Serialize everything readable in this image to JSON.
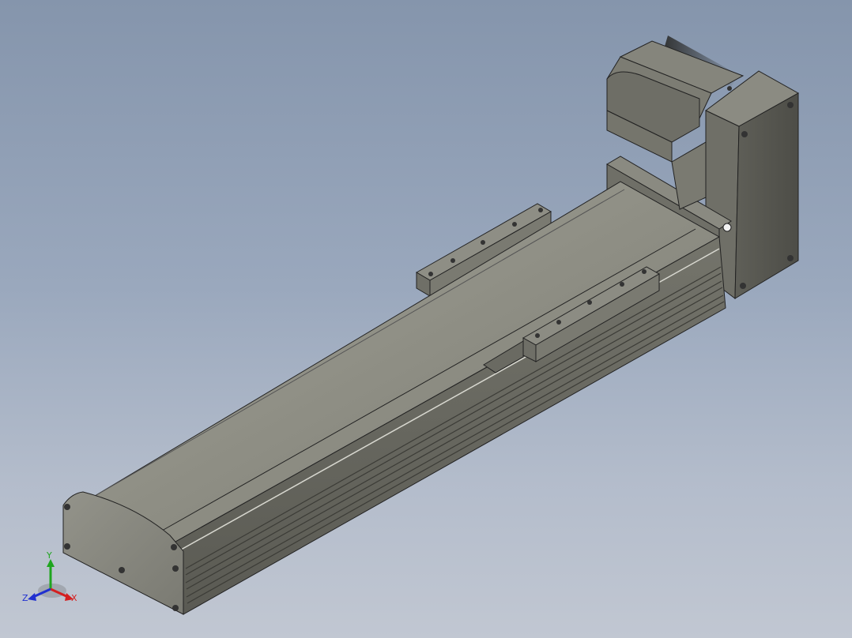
{
  "viewport": {
    "background_top": "#8595ac",
    "background_bottom": "#c1c7d2",
    "model_color": "#8a8a7f"
  },
  "triad": {
    "x_label": "X",
    "y_label": "Y",
    "z_label": "Z",
    "x_color": "#d42020",
    "y_color": "#1fa51f",
    "z_color": "#2030d0"
  }
}
